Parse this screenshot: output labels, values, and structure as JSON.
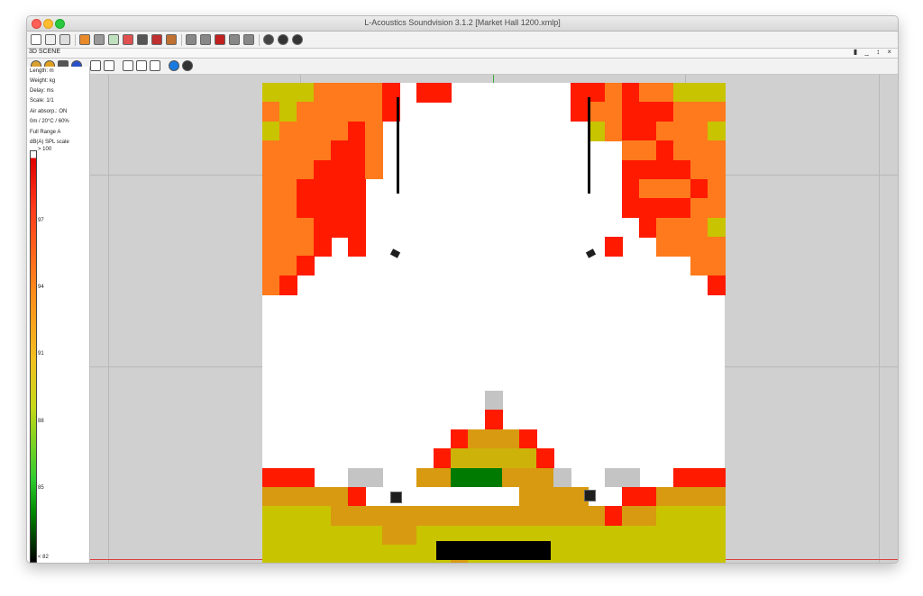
{
  "window": {
    "title": "L-Acoustics Soundvision 3.1.2 [Market Hall 1200.xmlp]"
  },
  "scene_panel": {
    "label": "3D SCENE",
    "controls": "▮ _ ↕ ×"
  },
  "info_lines": [
    "Length: m",
    "Weight: kg",
    "Delay: ms",
    "Scale: 1/1",
    "Air absorp.: ON",
    "0m / 20°C / 60%",
    "Full Range A",
    "dB(A) SPL scale"
  ],
  "spl_scale": {
    "top": "> 100",
    "bottom": "< 82",
    "ticks": [
      "97",
      "94",
      "91",
      "88",
      "85"
    ]
  },
  "toolbar_icons": [
    "new-file-icon",
    "open-folder-icon",
    "save-icon",
    "view-icon",
    "clip-icon",
    "snapshot-icon",
    "pencil-icon",
    "box-icon",
    "pyramid-icon",
    "speaker-icon",
    "grid-icon",
    "mapping-icon",
    "report-icon",
    "expand-icon",
    "layout-icon",
    "settings-icon",
    "help-icon",
    "more-icon"
  ],
  "scene_tool_icons": [
    "globe-icon",
    "compass-icon",
    "cube-icon",
    "dome-icon",
    "plane-view-icon",
    "plane-view-2-icon",
    "export-icon",
    "measure-icon",
    "pointer-icon",
    "info-icon",
    "help-circle-icon"
  ],
  "colors": {
    "red": "#ff1a00",
    "orange": "#ff7a1c",
    "yellow": "#c8c400",
    "green": "#007a00",
    "gray": "#c4c4c4"
  },
  "heatmap": {
    "rows": [
      "YYYOOOOR.RR.......RROROOYYY",
      "OYOOOOOR..........ROORRROOO",
      "YOOOORO............YORROOOY",
      "OOOORRO..............OOROOO",
      "OOORRRO..............RRRROO",
      "OORRRR...............ROOORO",
      "OORRRR...............RRRROO",
      "OOORRR................ROOOY",
      "OOOR.R..............R..OOOO",
      "OOR......................OO",
      "OR........................R",
      "...........................",
      "...........................",
      "...........................",
      "...........................",
      "...........................",
      ".............G.............",
      ".............R.............",
      "...........RMMMR...........",
      "..........RYYYYYR..........",
      "RRR..GG..MMGGGMMMG..GG..RRR",
      "MMMMMR.........MMMM..RRMMMM",
      "YYYYMMMMMMMMMMMMMMMMRMMYYYY",
      "YYYYYYYMMYYYYYYYYYYYYYYYYYY",
      "YYYYYYYYYYYMYYYYYYYYYYYYYYY",
      "YYYYYYYYYYYYYYYYYYYYYYYYYYY"
    ]
  }
}
